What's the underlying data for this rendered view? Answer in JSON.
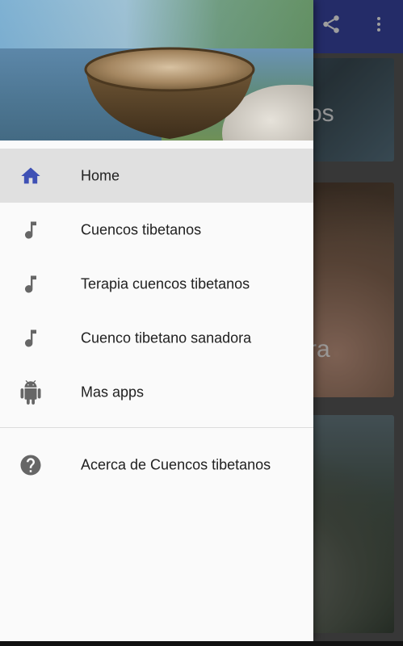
{
  "colors": {
    "primary": "#3a47a8",
    "active_icon": "#3f51b5",
    "icon_gray": "#666666",
    "active_row": "#e0e0e0"
  },
  "app_bar": {
    "actions": [
      {
        "icon": "share-icon"
      },
      {
        "icon": "more-vert-icon"
      }
    ]
  },
  "background_cards": [
    {
      "title_fragment": "os"
    },
    {
      "title_fragment": "ra"
    },
    {
      "title_fragment": ""
    }
  ],
  "drawer": {
    "items": [
      {
        "label": "Home",
        "icon": "home-icon",
        "active": true
      },
      {
        "label": "Cuencos tibetanos",
        "icon": "music-note-icon",
        "active": false
      },
      {
        "label": "Terapia cuencos tibetanos",
        "icon": "music-note-icon",
        "active": false
      },
      {
        "label": "Cuenco tibetano sanadora",
        "icon": "music-note-icon",
        "active": false
      },
      {
        "label": "Mas apps",
        "icon": "android-icon",
        "active": false
      }
    ],
    "secondary_items": [
      {
        "label": "Acerca de Cuencos tibetanos",
        "icon": "help-icon"
      }
    ]
  }
}
